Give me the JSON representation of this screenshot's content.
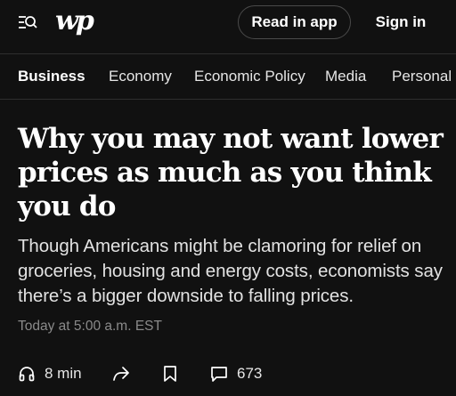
{
  "header": {
    "logo_text": "wp",
    "read_in_app": "Read in app",
    "sign_in": "Sign in"
  },
  "nav": {
    "items": [
      {
        "label": "Business",
        "active": true
      },
      {
        "label": "Economy"
      },
      {
        "label": "Economic Policy"
      },
      {
        "label": "Media"
      },
      {
        "label": "Personal F"
      }
    ]
  },
  "article": {
    "headline": "Why you may not want lower prices as much as you think you do",
    "dek": "Though Americans might be clamoring for relief on groceries, housing and energy costs, economists say there’s a bigger downside to falling prices.",
    "timestamp": "Today at 5:00 a.m. EST"
  },
  "actions": {
    "listen_label": "8 min",
    "comments_count": "673"
  },
  "icons": [
    "search-menu-icon",
    "headphones-icon",
    "share-icon",
    "bookmark-icon",
    "comment-icon"
  ]
}
